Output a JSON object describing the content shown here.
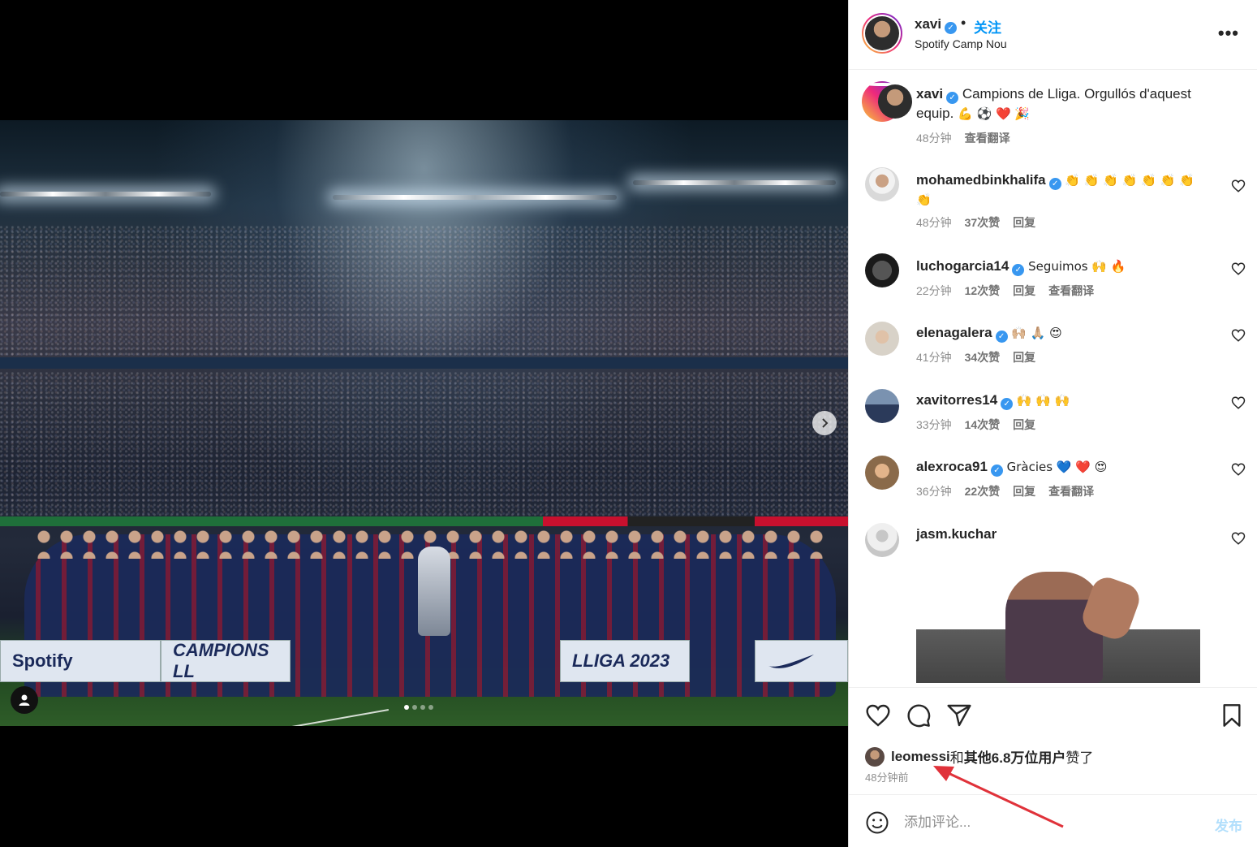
{
  "post": {
    "author": "xavi",
    "follow_label": "关注",
    "dot": "•",
    "location": "Spotify Camp Nou",
    "more_label": "•••",
    "caption_text": "Campions de Lliga. Orgullós d'aquest equip.",
    "caption_emojis": "💪 ⚽ ❤️ 🎉",
    "caption_time": "48分钟",
    "caption_translate": "查看翻译"
  },
  "media": {
    "board_spotify": "Spotify",
    "board_campions": "CAMPIONS LL",
    "board_liga": "LLIGA 2023",
    "carousel_count": 4,
    "carousel_active": 0
  },
  "comments": [
    {
      "user": "mohamedbinkhalifa",
      "verified": true,
      "text": "👏 👏 👏 👏 👏 👏 👏 👏",
      "time": "48分钟",
      "likes": "37次赞",
      "reply": "回复",
      "translate": ""
    },
    {
      "user": "luchogarcia14",
      "verified": true,
      "text": "Seguimos 🙌 🔥",
      "time": "22分钟",
      "likes": "12次赞",
      "reply": "回复",
      "translate": "查看翻译"
    },
    {
      "user": "elenagalera",
      "verified": true,
      "text": "🙌🏼 🙏🏼 😍",
      "time": "41分钟",
      "likes": "34次赞",
      "reply": "回复",
      "translate": ""
    },
    {
      "user": "xavitorres14",
      "verified": true,
      "text": "🙌 🙌 🙌",
      "time": "33分钟",
      "likes": "14次赞",
      "reply": "回复",
      "translate": ""
    },
    {
      "user": "alexroca91",
      "verified": true,
      "text": "Gràcies 💙 ❤️ 😍",
      "time": "36分钟",
      "likes": "22次赞",
      "reply": "回复",
      "translate": "查看翻译"
    },
    {
      "user": "jasm.kuchar",
      "verified": false,
      "text": "",
      "time": "",
      "likes": "",
      "reply": "",
      "translate": ""
    }
  ],
  "likes": {
    "first_user": "leomessi",
    "joiner": "和",
    "others": "其他6.8万位用户",
    "suffix": "赞了",
    "posted": "48分钟前"
  },
  "composer": {
    "placeholder": "添加评论...",
    "post_label": "发布"
  },
  "colors": {
    "accent": "#0095f6",
    "verified": "#3897f0",
    "annotation_arrow": "#e0323a",
    "post_disabled": "#b2dffc"
  },
  "icons": {
    "like": "heart-icon",
    "comment": "comment-icon",
    "share": "paper-plane-icon",
    "save": "bookmark-icon",
    "emoji": "smiley-icon",
    "next": "chevron-right-icon",
    "tag": "user-tag-icon",
    "more": "ellipsis-icon"
  }
}
